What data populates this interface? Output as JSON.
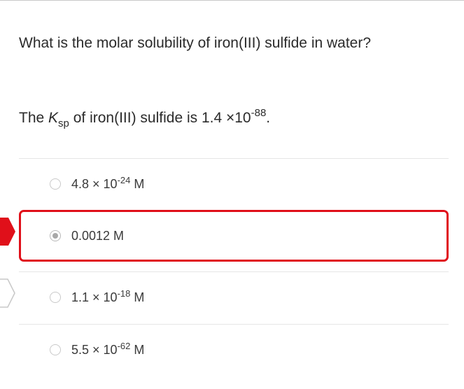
{
  "question": {
    "text": "What is the molar solubility of iron(III) sulfide in water?",
    "ksp_prefix": "The ",
    "ksp_symbol": "K",
    "ksp_subscript": "sp",
    "ksp_middle": " of iron(III) sulfide is 1.4 ×10",
    "ksp_exponent": "-88",
    "ksp_suffix": "."
  },
  "options": [
    {
      "mantissa": "4.8 × 10",
      "exponent": "-24",
      "unit": " M",
      "selected": false
    },
    {
      "text": "0.0012 M",
      "selected": true,
      "state": "incorrect"
    },
    {
      "mantissa": "1.1 × 10",
      "exponent": "-18",
      "unit": " M",
      "selected": false
    },
    {
      "mantissa": "5.5 × 10",
      "exponent": "-62",
      "unit": " M",
      "selected": false
    }
  ],
  "markers": {
    "incorrect_color": "#e0101a",
    "correct_outline_color": "#c8c8c8",
    "border_color": "#e0101a"
  }
}
